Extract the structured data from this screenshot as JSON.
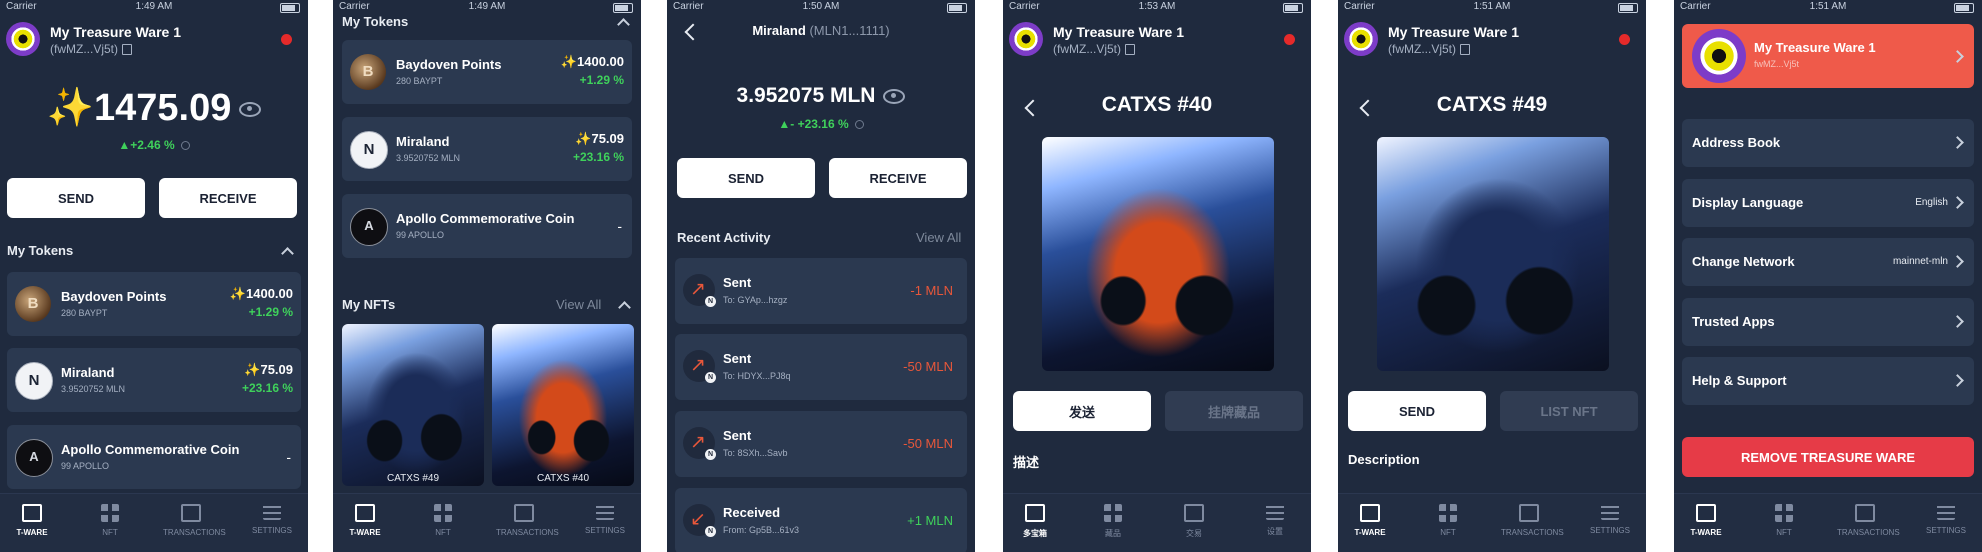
{
  "status": {
    "carrier": "Carrier",
    "times": [
      "1:49 AM",
      "1:49 AM",
      "1:50 AM",
      "1:53 AM",
      "1:51 AM",
      "1:51 AM"
    ]
  },
  "wallet": {
    "name": "My Treasure Ware 1",
    "address": "(fwMZ...Vj5t)",
    "address_short": "fwMZ...Vj5t"
  },
  "home": {
    "balance": "✨1475.09",
    "change": "+2.46 %",
    "send_label": "SEND",
    "receive_label": "RECEIVE",
    "tokens_title": "My Tokens",
    "nfts_title": "My NFTs",
    "view_all": "View All"
  },
  "tokens": [
    {
      "name": "Baydoven Points",
      "sub": "280 BAYPT",
      "amount": "✨1400.00",
      "change": "+1.29 %",
      "glyph": "B"
    },
    {
      "name": "Miraland",
      "sub": "3.9520752 MLN",
      "amount": "✨75.09",
      "change": "+23.16 %",
      "glyph": "N"
    },
    {
      "name": "Apollo Commemorative Coin",
      "sub": "99 APOLLO",
      "amount": "-",
      "change": "",
      "glyph": "A"
    }
  ],
  "nfts": [
    {
      "label": "CATXS #49"
    },
    {
      "label": "CATXS #40"
    }
  ],
  "miraland": {
    "title": "Miraland",
    "title_addr": "(MLN1...1111)",
    "balance": "3.952075 MLN",
    "change": "- +23.16 %",
    "send_label": "SEND",
    "receive_label": "RECEIVE",
    "recent_title": "Recent Activity",
    "view_all": "View All",
    "activity": [
      {
        "title": "Sent",
        "sub": "To: GYAp...hzgz",
        "amount": "-1 MLN",
        "arrow": "↗"
      },
      {
        "title": "Sent",
        "sub": "To: HDYX...PJ8q",
        "amount": "-50 MLN",
        "arrow": "↗"
      },
      {
        "title": "Sent",
        "sub": "To: 8SXh...Savb",
        "amount": "-50 MLN",
        "arrow": "↗"
      },
      {
        "title": "Received",
        "sub": "From: Gp5B...61v3",
        "amount": "+1 MLN",
        "arrow": "↙"
      }
    ]
  },
  "nft40": {
    "title": "CATXS #40",
    "send_label": "发送",
    "list_label": "挂牌藏品",
    "desc_title": "描述"
  },
  "nft49": {
    "title": "CATXS #49",
    "send_label": "SEND",
    "list_label": "LIST NFT",
    "desc_title": "Description"
  },
  "settings": {
    "rows": [
      {
        "label": "Address Book",
        "value": ""
      },
      {
        "label": "Display Language",
        "value": "English"
      },
      {
        "label": "Change Network",
        "value": "mainnet-mln"
      },
      {
        "label": "Trusted Apps",
        "value": ""
      },
      {
        "label": "Help & Support",
        "value": ""
      }
    ],
    "remove_label": "REMOVE TREASURE WARE"
  },
  "tabbar_en": [
    "T-WARE",
    "NFT",
    "TRANSACTIONS",
    "SETTINGS"
  ],
  "tabbar_zh": [
    "多宝箱",
    "藏品",
    "交易",
    "设置"
  ],
  "colors": {
    "background": "#1f2a3e",
    "card": "#2b3950",
    "positive": "#3fd15b",
    "negative": "#e8573a",
    "danger": "#e63b47",
    "profile_card": "#ef5a4a"
  }
}
